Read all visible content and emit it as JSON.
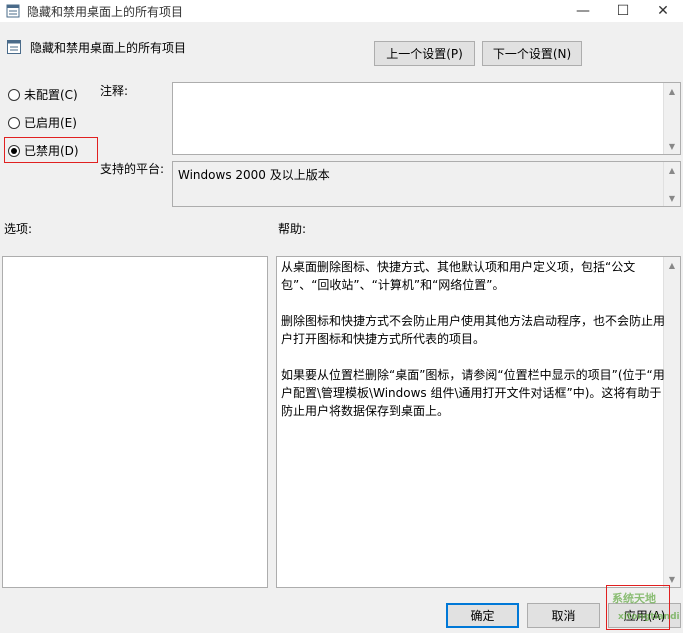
{
  "window": {
    "title": "隐藏和禁用桌面上的所有项目",
    "minimize_glyph": "—",
    "maximize_glyph": "☐",
    "close_glyph": "✕"
  },
  "header": {
    "policy_name": "隐藏和禁用桌面上的所有项目",
    "prev_button": "上一个设置(P)",
    "next_button": "下一个设置(N)"
  },
  "config": {
    "options": [
      {
        "label": "未配置(C)",
        "checked": false
      },
      {
        "label": "已启用(E)",
        "checked": false
      },
      {
        "label": "已禁用(D)",
        "checked": true
      }
    ]
  },
  "comment": {
    "label": "注释:",
    "value": ""
  },
  "platform": {
    "label": "支持的平台:",
    "value": "Windows 2000 及以上版本"
  },
  "options_section": {
    "label": "选项:"
  },
  "help_section": {
    "label": "帮助:",
    "text": "从桌面删除图标、快捷方式、其他默认项和用户定义项，包括“公文包”、“回收站”、“计算机”和“网络位置”。\n\n删除图标和快捷方式不会防止用户使用其他方法启动程序，也不会防止用户打开图标和快捷方式所代表的项目。\n\n如果要从位置栏删除“桌面”图标，请参阅“位置栏中显示的项目”(位于“用户配置\\管理模板\\Windows 组件\\通用打开文件对话框”中)。这将有助于防止用户将数据保存到桌面上。"
  },
  "footer": {
    "ok_button": "确定",
    "cancel_button": "取消",
    "apply_button": "应用(A)"
  },
  "watermark": {
    "text": "系统天地",
    "domain": "xitongtiandi"
  },
  "colors": {
    "highlight": "#e02020",
    "primary_border": "#0078d7"
  }
}
